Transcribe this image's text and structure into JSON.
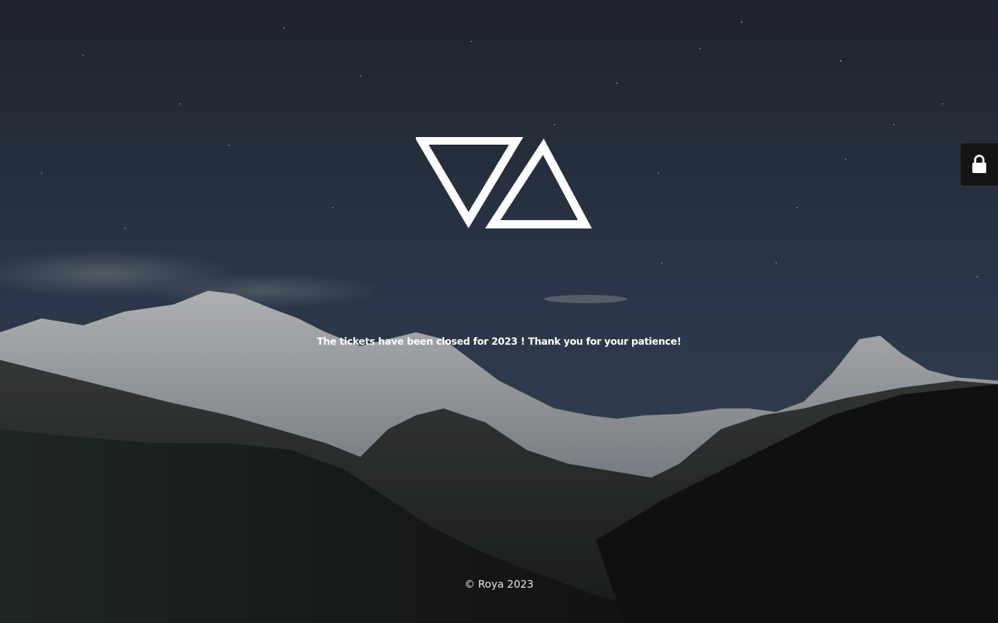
{
  "page": {
    "message": "The tickets have been closed for 2023 ! Thank you for your patience!",
    "footer": "© Roya 2023"
  },
  "logo": {
    "name": "triangle-logo"
  },
  "login": {
    "icon": "lock-icon"
  },
  "colors": {
    "sky_top": "#232a37",
    "sky_mid": "#334256",
    "snow": "#c9ccd0",
    "mountain_dark": "#141414",
    "text": "#ffffff"
  }
}
